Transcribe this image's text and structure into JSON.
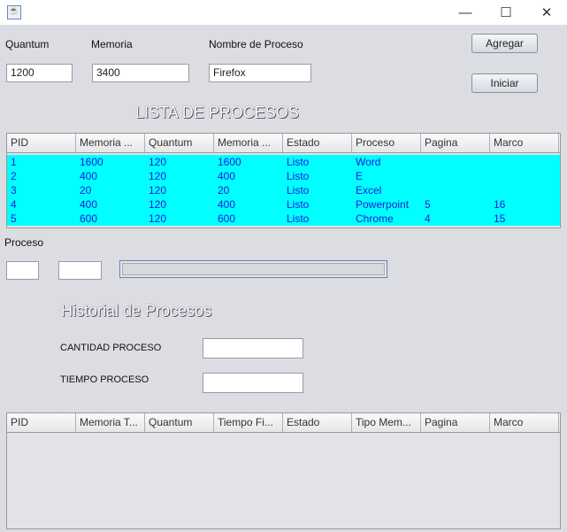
{
  "window": {
    "app_icon": "java-icon",
    "minimize": "—",
    "maximize": "☐",
    "close": "✕"
  },
  "form": {
    "quantum_label": "Quantum",
    "quantum_value": "1200",
    "memoria_label": "Memoria",
    "memoria_value": "3400",
    "nombre_label": "Nombre de Proceso",
    "nombre_value": "Firefox",
    "agregar": "Agregar",
    "iniciar": "Iniciar"
  },
  "lista": {
    "title": "LISTA DE PROCESOS",
    "columns": [
      "PID",
      "Memoria ...",
      "Quantum",
      "Memoria ...",
      "Estado",
      "Proceso",
      "Pagina",
      "Marco"
    ],
    "rows": [
      [
        "1",
        "1600",
        "120",
        "1600",
        "Listo",
        "Word",
        "",
        ""
      ],
      [
        "2",
        "400",
        "120",
        "400",
        "Listo",
        "E",
        "",
        ""
      ],
      [
        "3",
        "20",
        "120",
        "20",
        "Listo",
        "Excel",
        "",
        ""
      ],
      [
        "4",
        "400",
        "120",
        "400",
        "Listo",
        "Powerpoint",
        "5",
        "16"
      ],
      [
        "5",
        "600",
        "120",
        "600",
        "Listo",
        "Chrome",
        "4",
        "15"
      ]
    ],
    "row_color": "#00ffff",
    "text_color": "#1a1ad8"
  },
  "proceso": {
    "label": "Proceso",
    "field1": "",
    "field2": "",
    "progress": 0
  },
  "historial": {
    "title": "Historial de Procesos",
    "cantidad_label": "CANTIDAD PROCESO",
    "cantidad_value": "",
    "tiempo_label": "TIEMPO PROCESO",
    "tiempo_value": "",
    "columns": [
      "PID",
      "Memoria T...",
      "Quantum",
      "Tiempo Fi...",
      "Estado",
      "Tipo Mem...",
      "Pagina",
      "Marco"
    ]
  }
}
